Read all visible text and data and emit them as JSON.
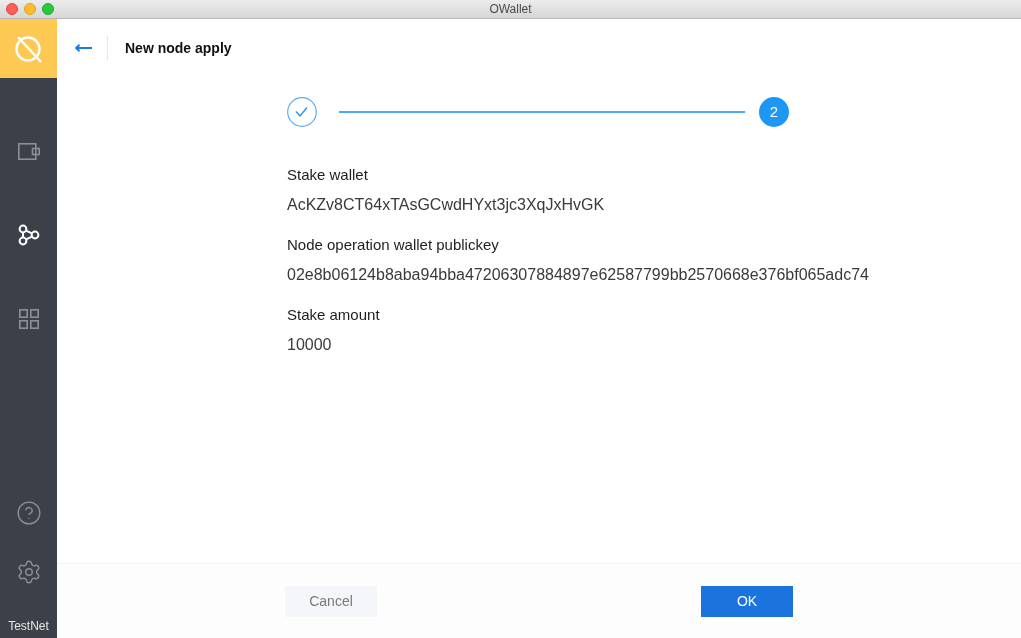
{
  "window": {
    "title": "OWallet"
  },
  "sidebar": {
    "items": [
      {
        "kind": "wallet",
        "selected": false
      },
      {
        "kind": "node",
        "selected": true
      },
      {
        "kind": "apps",
        "selected": false
      }
    ],
    "network": "TestNet"
  },
  "header": {
    "title": "New node apply"
  },
  "stepper": {
    "steps": [
      {
        "completed": true,
        "selected": false
      },
      {
        "number": "2",
        "completed": false,
        "selected": true
      }
    ]
  },
  "fields": [
    {
      "label": "Stake wallet",
      "value": "AcKZv8CT64xTAsGCwdHYxt3jc3XqJxHvGK"
    },
    {
      "label": "Node operation wallet publickey",
      "value": "02e8b06124b8aba94bba47206307884897e62587799bb2570668e376bf065adc74"
    },
    {
      "label": "Stake amount",
      "value": "10000"
    }
  ],
  "buttons": [
    {
      "label": "Cancel",
      "kind": "secondary"
    },
    {
      "label": "OK",
      "kind": "primary"
    }
  ]
}
